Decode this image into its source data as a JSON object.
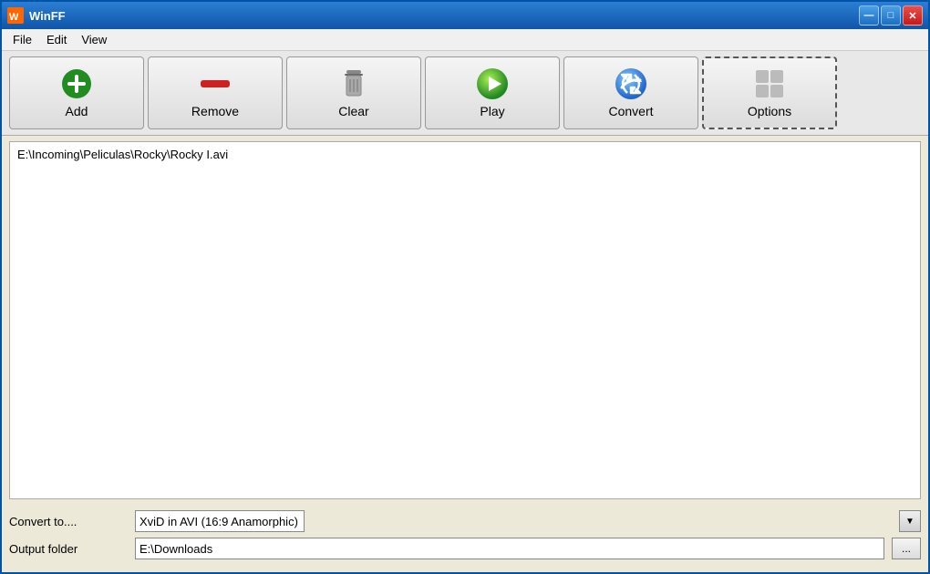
{
  "window": {
    "title": "WinFF",
    "title_icon": "W"
  },
  "title_controls": {
    "minimize": "—",
    "maximize": "□",
    "close": "✕"
  },
  "menu": {
    "items": [
      "File",
      "Edit",
      "View"
    ]
  },
  "toolbar": {
    "buttons": [
      {
        "id": "add",
        "label": "Add"
      },
      {
        "id": "remove",
        "label": "Remove"
      },
      {
        "id": "clear",
        "label": "Clear"
      },
      {
        "id": "play",
        "label": "Play"
      },
      {
        "id": "convert",
        "label": "Convert"
      },
      {
        "id": "options",
        "label": "Options"
      }
    ]
  },
  "file_list": {
    "items": [
      "E:\\Incoming\\Peliculas\\Rocky\\Rocky I.avi"
    ]
  },
  "bottom": {
    "convert_label": "Convert to....",
    "convert_value": "XviD in AVI (16:9 Anamorphic)",
    "output_label": "Output folder",
    "output_value": "E:\\Downloads",
    "browse_label": "..."
  }
}
